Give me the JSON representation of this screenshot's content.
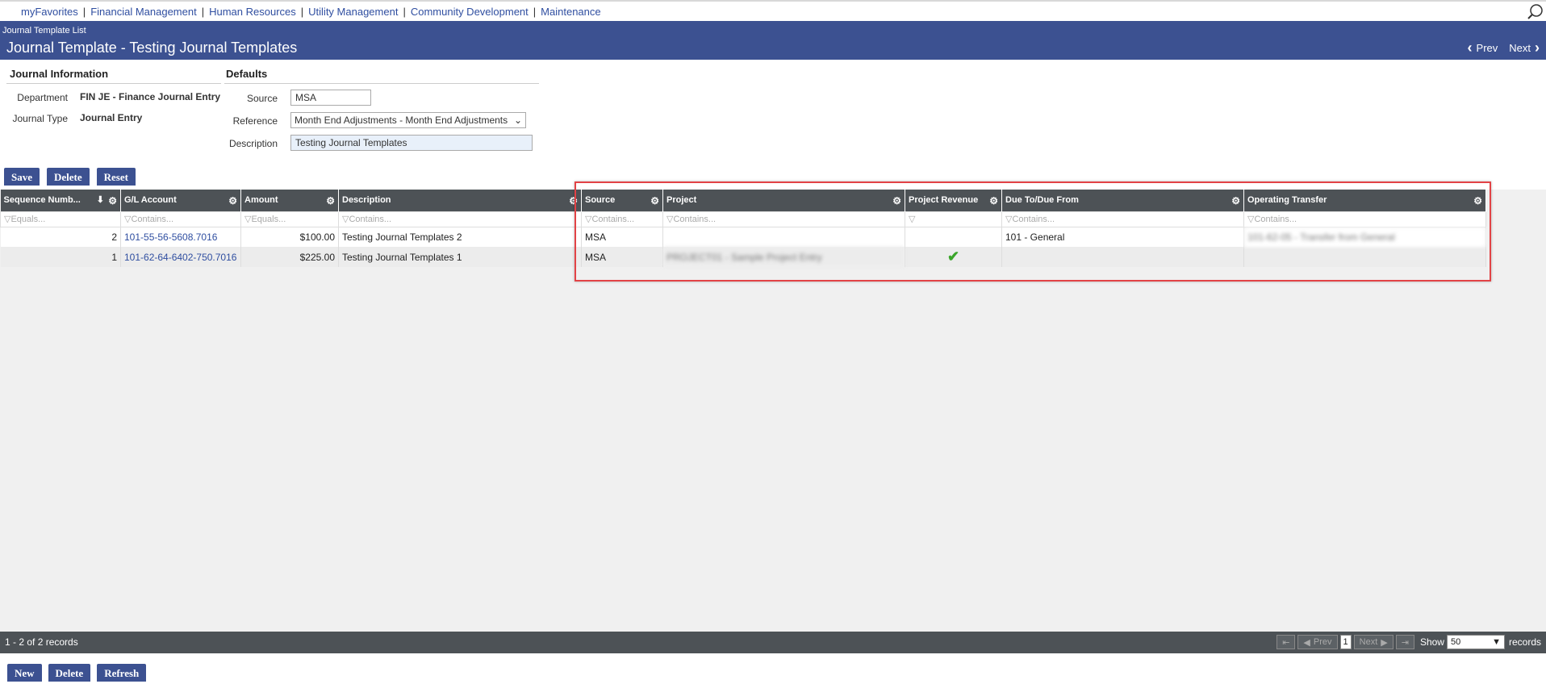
{
  "topnav": {
    "items": [
      "myFavorites",
      "Financial Management",
      "Human Resources",
      "Utility Management",
      "Community Development",
      "Maintenance"
    ],
    "search_icon": "search-icon"
  },
  "header": {
    "breadcrumb": "Journal Template List",
    "title": "Journal Template - Testing Journal Templates",
    "prev": "Prev",
    "next": "Next"
  },
  "journal_info": {
    "heading": "Journal Information",
    "department_label": "Department",
    "department_value": "FIN JE - Finance Journal Entry",
    "type_label": "Journal Type",
    "type_value": "Journal Entry"
  },
  "defaults": {
    "heading": "Defaults",
    "source_label": "Source",
    "source_value": "MSA",
    "reference_label": "Reference",
    "reference_value": "Month End Adjustments - Month End Adjustments",
    "description_label": "Description",
    "description_value": "Testing Journal Templates"
  },
  "actions": {
    "save": "Save",
    "delete": "Delete",
    "reset": "Reset"
  },
  "grid": {
    "columns": [
      "Sequence Numb...",
      "G/L Account",
      "Amount",
      "Description",
      "Source",
      "Project",
      "Project Revenue",
      "Due To/Due From",
      "Operating Transfer"
    ],
    "filters": [
      "Equals...",
      "Contains...",
      "Equals...",
      "Contains...",
      "Contains...",
      "Contains...",
      "",
      "Contains...",
      "Contains..."
    ],
    "rows": [
      {
        "seq": "2",
        "gl": "101-55-56-5608.7016",
        "amount": "$100.00",
        "desc": "Testing Journal Templates 2",
        "source": "MSA",
        "project": "",
        "revenue": false,
        "dueto": "101 - General",
        "transfer": "101-62-05 - Transfer from General"
      },
      {
        "seq": "1",
        "gl": "101-62-64-6402-750.7016",
        "amount": "$225.00",
        "desc": "Testing Journal Templates 1",
        "source": "MSA",
        "project": "PROJECT01 - Sample Project Entry",
        "revenue": true,
        "dueto": "",
        "transfer": ""
      }
    ]
  },
  "footer": {
    "count": "1 - 2 of 2 records",
    "prev": "Prev",
    "next": "Next",
    "page": "1",
    "show_label": "Show",
    "show_value": "50",
    "records_label": "records"
  },
  "bottom": {
    "new": "New",
    "delete": "Delete",
    "refresh": "Refresh"
  },
  "colors": {
    "brand": "#3c5191",
    "grid_header": "#4d5256",
    "highlight": "#e24346",
    "check": "#3aa52a"
  }
}
